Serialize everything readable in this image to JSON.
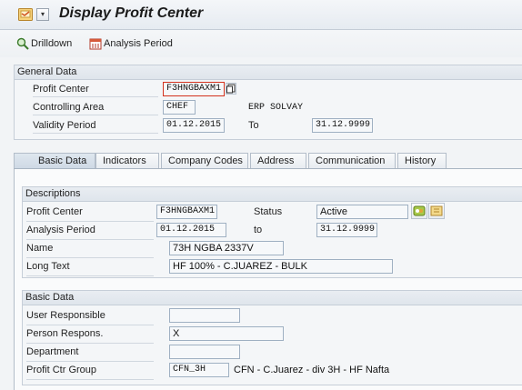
{
  "title": "Display Profit Center",
  "toolbar": {
    "drilldown": "Drilldown",
    "analysis_period": "Analysis Period"
  },
  "general": {
    "header": "General Data",
    "profit_center_label": "Profit Center",
    "profit_center_value": "F3HNGBAXM1",
    "controlling_area_label": "Controlling Area",
    "controlling_area_value": "CHEF",
    "controlling_area_desc": "ERP SOLVAY",
    "validity_label": "Validity Period",
    "validity_from": "01.12.2015",
    "to_label": "To",
    "validity_to": "31.12.9999"
  },
  "tabs": [
    {
      "label": "Basic Data",
      "active": true
    },
    {
      "label": "Indicators",
      "active": false
    },
    {
      "label": "Company Codes",
      "active": false
    },
    {
      "label": "Address",
      "active": false
    },
    {
      "label": "Communication",
      "active": false
    },
    {
      "label": "History",
      "active": false
    }
  ],
  "descriptions": {
    "header": "Descriptions",
    "profit_center_label": "Profit Center",
    "profit_center_value": "F3HNGBAXM1",
    "status_label": "Status",
    "status_value": "Active",
    "analysis_period_label": "Analysis Period",
    "analysis_from": "01.12.2015",
    "to_label": "to",
    "analysis_to": "31.12.9999",
    "name_label": "Name",
    "name_value": "73H  NGBA 2337V",
    "long_text_label": "Long Text",
    "long_text_value": "HF 100% - C.JUAREZ - BULK"
  },
  "basic": {
    "header": "Basic Data",
    "user_responsible_label": "User Responsible",
    "user_responsible_value": "",
    "person_respons_label": "Person Respons.",
    "person_respons_value": "X",
    "department_label": "Department",
    "department_value": "",
    "group_label": "Profit Ctr Group",
    "group_value": "CFN_3H",
    "group_desc": "CFN - C.Juarez - div 3H - HF Nafta"
  }
}
